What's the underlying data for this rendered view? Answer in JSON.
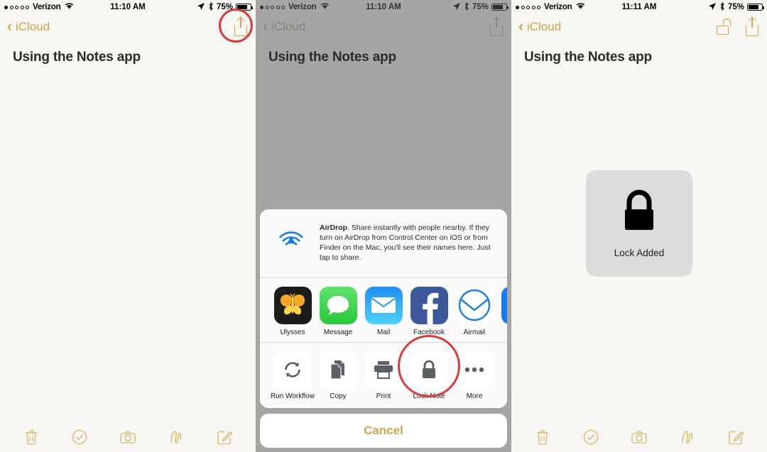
{
  "panels": [
    {
      "name": "panel-share-button",
      "status": {
        "carrier": "Verizon",
        "time": "11:10 AM",
        "battery_pct": "75%"
      },
      "nav": {
        "back_label": "iCloud",
        "share_icon": "share-icon"
      },
      "note_title": "Using the Notes app",
      "highlight": "share-button"
    },
    {
      "name": "panel-share-sheet",
      "status": {
        "carrier": "Verizon",
        "time": "11:10 AM",
        "battery_pct": "75%"
      },
      "nav": {
        "back_label": "iCloud",
        "share_icon": "share-icon"
      },
      "note_title": "Using the Notes app",
      "highlight": "lock-note-action"
    },
    {
      "name": "panel-lock-added",
      "status": {
        "carrier": "Verizon",
        "time": "11:11 AM",
        "battery_pct": "75%"
      },
      "nav": {
        "back_label": "iCloud",
        "unlock_icon": "unlock-icon",
        "share_icon": "share-icon"
      },
      "note_title": "Using the Notes app",
      "hud": {
        "icon": "lock-closed-icon",
        "label": "Lock Added"
      }
    }
  ],
  "share_sheet": {
    "airdrop": {
      "title": "AirDrop",
      "description": ". Share instantly with people nearby. If they turn on AirDrop from Control Center on iOS or from Finder on the Mac, you'll see their names here. Just tap to share."
    },
    "apps": [
      {
        "label": "Ulysses",
        "icon": "ulysses-butterfly-icon",
        "color": "#1c1c1c"
      },
      {
        "label": "Message",
        "icon": "messages-bubble-icon",
        "color": "#4cd964"
      },
      {
        "label": "Mail",
        "icon": "mail-envelope-icon",
        "color": "#2f9bf5"
      },
      {
        "label": "Facebook",
        "icon": "facebook-f-icon",
        "color": "#3b5998"
      },
      {
        "label": "Airmail",
        "icon": "airmail-circle-icon",
        "color": "#ffffff"
      },
      {
        "label": "",
        "icon": "partial-app-icon",
        "color": "#1778f2"
      }
    ],
    "actions": [
      {
        "label": "Run Workflow",
        "icon": "refresh-loop-icon"
      },
      {
        "label": "Copy",
        "icon": "copy-pages-icon"
      },
      {
        "label": "Print",
        "icon": "printer-icon"
      },
      {
        "label": "Lock Note",
        "icon": "lock-closed-icon"
      },
      {
        "label": "More",
        "icon": "more-dots-icon"
      }
    ],
    "cancel_label": "Cancel"
  },
  "toolbar": {
    "items": [
      {
        "icon": "trash-icon"
      },
      {
        "icon": "checkmark-circle-icon"
      },
      {
        "icon": "camera-icon"
      },
      {
        "icon": "squiggle-draw-icon"
      },
      {
        "icon": "compose-icon"
      }
    ]
  },
  "colors": {
    "accent_gold": "#c8a84b",
    "toolbar_gold": "#d8c27c",
    "highlight_red": "#d93b3b",
    "page_bg": "#f7f6f3"
  }
}
